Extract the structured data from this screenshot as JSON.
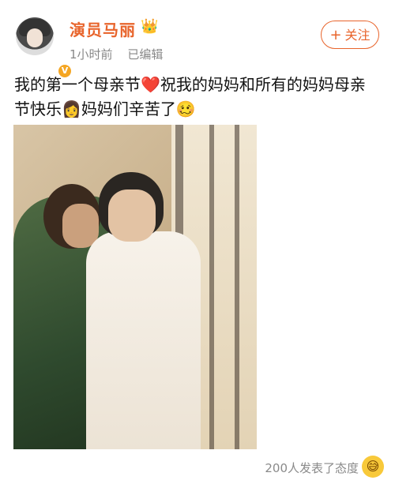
{
  "user": {
    "name": "演员马丽",
    "time": "1小时前",
    "edited": "已编辑",
    "follow_label": "关注",
    "follow_plus": "+"
  },
  "post": {
    "line1": "我的第一个母亲节❤️祝我的妈妈和所有的妈妈母亲",
    "line2": "节快乐👩妈妈们辛苦了🥴"
  },
  "footer": {
    "reactions": "200人发表了态度",
    "reaction_emoji": "😅"
  },
  "colors": {
    "name": "#e8642b",
    "follow": "#e8642b",
    "verify": "#f5a623",
    "meta": "#888888"
  },
  "icons": {
    "crown": "crown-icon",
    "verify": "verified-badge-icon",
    "reaction": "laughing-emoji-icon"
  }
}
